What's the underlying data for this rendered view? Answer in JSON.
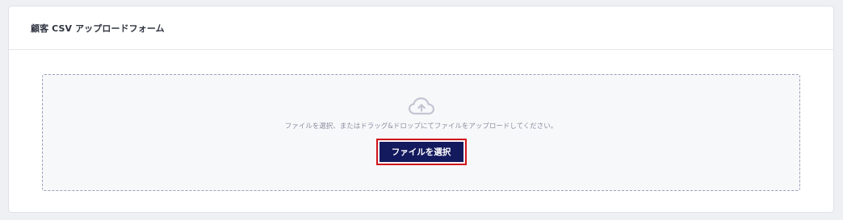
{
  "card": {
    "title": "顧客 CSV アップロードフォーム"
  },
  "dropzone": {
    "icon": "cloud-upload-icon",
    "instruction": "ファイルを選択、またはドラッグ&ドロップにてファイルをアップロードしてください。",
    "button_label": "ファイルを選択"
  },
  "colors": {
    "button_bg": "#141a5e",
    "highlight_border": "#d0141b",
    "icon": "#c3c6d2"
  }
}
